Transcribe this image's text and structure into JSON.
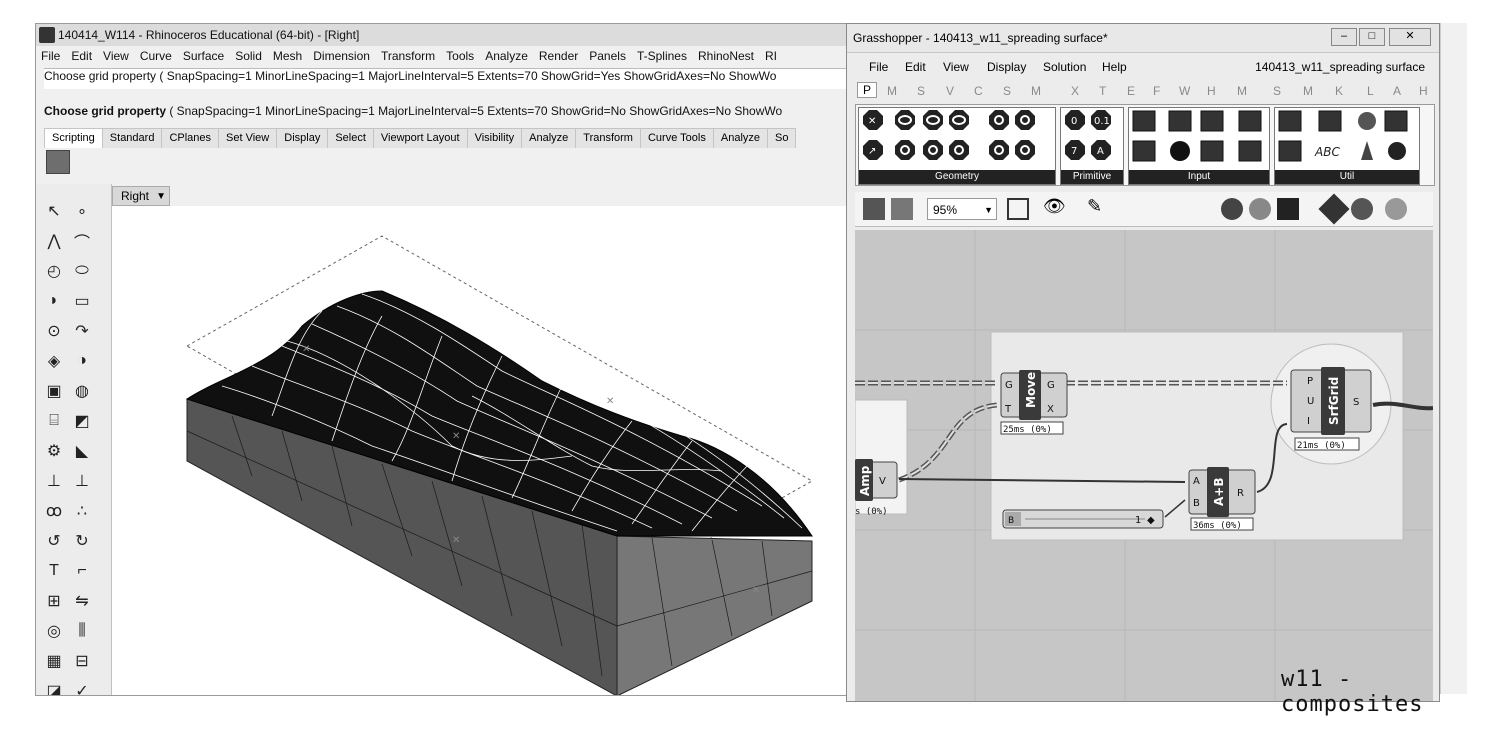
{
  "rhino": {
    "title": "140414_W114 - Rhinoceros Educational (64-bit) - [Right]",
    "menu": [
      "File",
      "Edit",
      "View",
      "Curve",
      "Surface",
      "Solid",
      "Mesh",
      "Dimension",
      "Transform",
      "Tools",
      "Analyze",
      "Render",
      "Panels",
      "T-Splines",
      "RhinoNest",
      "RI"
    ],
    "command_history": "Choose grid property ( SnapSpacing=1  MinorLineSpacing=1  MajorLineInterval=5  Extents=70  ShowGrid=Yes  ShowGridAxes=No  ShowWo",
    "command_prompt_head": "Choose grid property",
    "command_prompt_rest": " ( SnapSpacing=1  MinorLineSpacing=1  MajorLineInterval=5  Extents=70  ShowGrid=No  ShowGridAxes=No  ShowWo",
    "tabs": [
      "Scripting",
      "Standard",
      "CPlanes",
      "Set View",
      "Display",
      "Select",
      "Viewport Layout",
      "Visibility",
      "Analyze",
      "Transform",
      "Curve Tools",
      "Analyze",
      "So"
    ],
    "active_tab": "Scripting",
    "viewport_label": "Right"
  },
  "grasshopper": {
    "title": "Grasshopper - 140413_w11_spreading surface*",
    "menu": [
      "File",
      "Edit",
      "View",
      "Display",
      "Solution",
      "Help"
    ],
    "document_name": "140413_w11_spreading surface",
    "tabs": [
      "P",
      "M",
      "S",
      "V",
      "C",
      "S",
      "M",
      "X",
      "T",
      "E",
      "F",
      "W",
      "H",
      "M",
      "S",
      "M",
      "K",
      "L",
      "A",
      "H"
    ],
    "active_tab": "P",
    "ribbon_groups": [
      "Geometry",
      "Primitive",
      "Input",
      "Util"
    ],
    "zoom": "95%",
    "components": {
      "move": {
        "name": "Move",
        "inputs": [
          "G",
          "T"
        ],
        "outputs": [
          "G",
          "X"
        ],
        "time": "25ms (0%)"
      },
      "srfgrid": {
        "name": "SrfGrid",
        "inputs": [
          "P",
          "U",
          "I"
        ],
        "outputs": [
          "S"
        ],
        "time": "21ms (0%)"
      },
      "addition": {
        "name": "A+B",
        "inputs": [
          "A",
          "B"
        ],
        "outputs": [
          "R"
        ],
        "time": "36ms (0%)"
      },
      "amp": {
        "name": "Amp",
        "outputs": [
          "V"
        ],
        "time": "s (0%)"
      },
      "slider": {
        "label": "B",
        "value": "1"
      }
    }
  },
  "caption": "w11 - composites"
}
